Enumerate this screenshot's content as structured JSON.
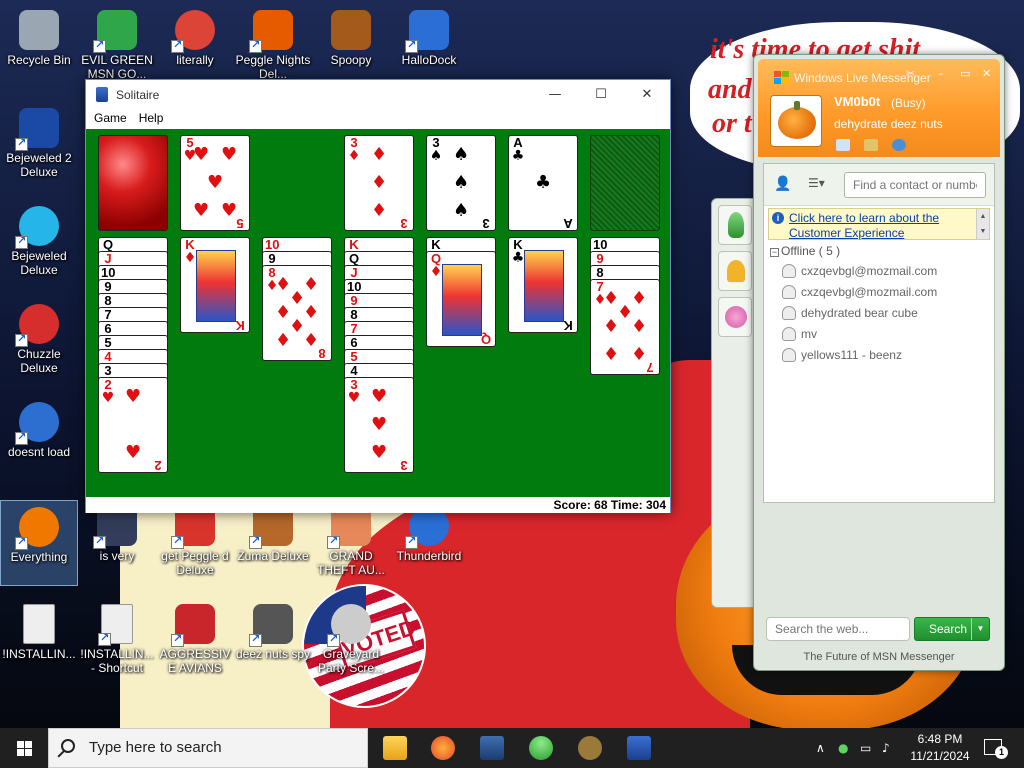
{
  "wallpaper": {
    "speech_line1": "it's time to get shit",
    "speech_line2": "and",
    "speech_line3": "or t",
    "sticker_text": "VOTED"
  },
  "desktop": {
    "icons": [
      {
        "label": "Recycle Bin"
      },
      {
        "label": "EVIL GREEN MSN GO..."
      },
      {
        "label": "literally"
      },
      {
        "label": "Peggle Nights Del..."
      },
      {
        "label": "Spoopy"
      },
      {
        "label": "HalloDock"
      },
      {
        "label": "Bejeweled 2 Deluxe"
      },
      {
        "label": "Bejeweled Deluxe"
      },
      {
        "label": "Chuzzle Deluxe"
      },
      {
        "label": "doesnt load"
      },
      {
        "label": "Everything"
      },
      {
        "label": "is very"
      },
      {
        "label": "get Peggle d Deluxe"
      },
      {
        "label": "Zuma Deluxe"
      },
      {
        "label": "GRAND THEFT AU..."
      },
      {
        "label": "Thunderbird"
      },
      {
        "label": "!INSTALLIN..."
      },
      {
        "label": "!INSTALLIN... - Shortcut"
      },
      {
        "label": "AGGRESSIVE AVIANS"
      },
      {
        "label": "deez nuts spy"
      },
      {
        "label": "Graveyard Party Scre..."
      }
    ]
  },
  "solitaire": {
    "title": "Solitaire",
    "menu": [
      "Game",
      "Help"
    ],
    "window_buttons": {
      "minimize": "—",
      "maximize": "☐",
      "close": "✕"
    },
    "status": "Score: 68  Time: 304",
    "top_row": [
      {
        "type": "back"
      },
      {
        "rank": "5",
        "suit": "♥",
        "color": "red"
      },
      {
        "type": "none"
      },
      {
        "rank": "3",
        "suit": "♦",
        "color": "red"
      },
      {
        "rank": "3",
        "suit": "♠",
        "color": "black"
      },
      {
        "rank": "A",
        "suit": "♣",
        "color": "black"
      },
      {
        "type": "slot"
      }
    ],
    "tableau": [
      {
        "stack": [
          [
            "Q",
            "♠"
          ],
          [
            "J",
            "♥"
          ],
          [
            "10",
            "♠"
          ],
          [
            "9",
            "♣"
          ],
          [
            "8",
            "♠"
          ],
          [
            "7",
            "♣"
          ],
          [
            "6",
            "♠"
          ],
          [
            "5",
            "♣"
          ],
          [
            "4",
            "♥"
          ],
          [
            "3",
            "♠"
          ]
        ],
        "top": {
          "rank": "2",
          "suit": "♥",
          "color": "red"
        }
      },
      {
        "stack": [],
        "top": {
          "rank": "K",
          "suit": "♦",
          "color": "red",
          "face": true
        }
      },
      {
        "stack": [
          [
            "10",
            "♦"
          ],
          [
            "9",
            "♠"
          ]
        ],
        "top": {
          "rank": "8",
          "suit": "♦",
          "color": "red"
        }
      },
      {
        "stack": [
          [
            "K",
            "♦"
          ],
          [
            "Q",
            "♠"
          ],
          [
            "J",
            "♥"
          ],
          [
            "10",
            "♣"
          ],
          [
            "9",
            "♥"
          ],
          [
            "8",
            "♠"
          ],
          [
            "7",
            "♥"
          ],
          [
            "6",
            "♠"
          ],
          [
            "5",
            "♥"
          ],
          [
            "4",
            "♠"
          ]
        ],
        "top": {
          "rank": "3",
          "suit": "♥",
          "color": "red"
        }
      },
      {
        "stack": [
          [
            "K",
            "♠"
          ]
        ],
        "top": {
          "rank": "Q",
          "suit": "♦",
          "color": "red",
          "face": true
        }
      },
      {
        "stack": [],
        "top": {
          "rank": "K",
          "suit": "♣",
          "color": "black",
          "face": true
        }
      },
      {
        "stack": [
          [
            "10",
            "♠"
          ],
          [
            "9",
            "♥"
          ],
          [
            "8",
            "♠"
          ]
        ],
        "top": {
          "rank": "7",
          "suit": "♦",
          "color": "red"
        }
      }
    ]
  },
  "msn": {
    "window_title": "Windows Live Messenger",
    "username": "VM0b0t",
    "status": "(Busy)",
    "personal_message": "dehydrate deez nuts",
    "find_placeholder": "Find a contact or number...",
    "notice_text": "Click here to learn about the Customer Experience",
    "group_label": "Offline ( 5 )",
    "contacts": [
      "cxzqevbgl@mozmail.com",
      "cxzqevbgl@mozmail.com",
      "dehydrated bear cube",
      "mv",
      "yellows111 - beenz"
    ],
    "search_placeholder": "Search the web...",
    "search_button": "Search",
    "footer": "The Future of MSN Messenger",
    "window_buttons": {
      "minimize": "–",
      "maximize": "▭",
      "close": "✕"
    }
  },
  "taskbar": {
    "search_placeholder": "Type here to search",
    "time": "6:48 PM",
    "date": "11/21/2024",
    "notification_count": "1",
    "tray_chevron": "∧"
  }
}
